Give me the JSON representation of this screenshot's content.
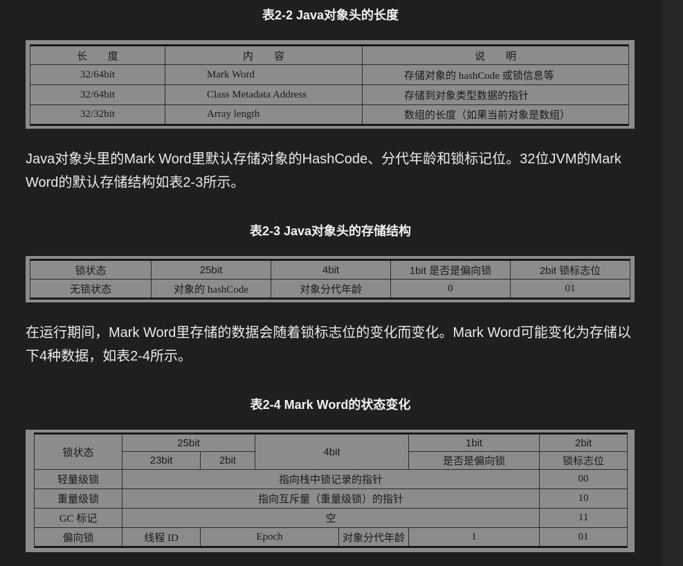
{
  "table22": {
    "caption": "表2-2 Java对象头的长度",
    "headers": [
      "长　　度",
      "内　　容",
      "说　　明"
    ],
    "rows": [
      [
        "32/64bit",
        "Mark Word",
        "存储对象的 hashCode 或锁信息等"
      ],
      [
        "32/64bit",
        "Class Metadata Address",
        "存储到对象类型数据的指针"
      ],
      [
        "32/32bit",
        "Array length",
        "数组的长度（如果当前对象是数组）"
      ]
    ]
  },
  "para1": "Java对象头里的Mark Word里默认存储对象的HashCode、分代年龄和锁标记位。32位JVM的Mark Word的默认存储结构如表2-3所示。",
  "table23": {
    "caption": "表2-3 Java对象头的存储结构",
    "headers": [
      "锁状态",
      "25bit",
      "4bit",
      "1bit 是否是偏向锁",
      "2bit 锁标志位"
    ],
    "row": [
      "无锁状态",
      "对象的 hashCode",
      "对象分代年龄",
      "0",
      "01"
    ]
  },
  "para2": "在运行期间，Mark Word里存储的数据会随着锁标志位的变化而变化。Mark Word可能变化为存储以下4种数据，如表2-4所示。",
  "table24": {
    "caption": "表2-4 Mark Word的状态变化",
    "h_lock": "锁状态",
    "h_25bit": "25bit",
    "h_4bit": "4bit",
    "h_1bit": "1bit",
    "h_2bit": "2bit",
    "h_23bit": "23bit",
    "h_2bit_sub": "2bit",
    "h_biased": "是否是偏向锁",
    "h_flag": "锁标志位",
    "rows": [
      {
        "state": "轻量级锁",
        "content": "指向栈中锁记录的指针",
        "flag": "00"
      },
      {
        "state": "重量级锁",
        "content": "指向互斥量（重量级锁）的指针",
        "flag": "10"
      },
      {
        "state": "GC 标记",
        "content": "空",
        "flag": "11"
      }
    ],
    "biased": {
      "state": "偏向锁",
      "thread": "线程 ID",
      "epoch": "Epoch",
      "age": "对象分代年龄",
      "bit": "1",
      "flag": "01"
    }
  }
}
